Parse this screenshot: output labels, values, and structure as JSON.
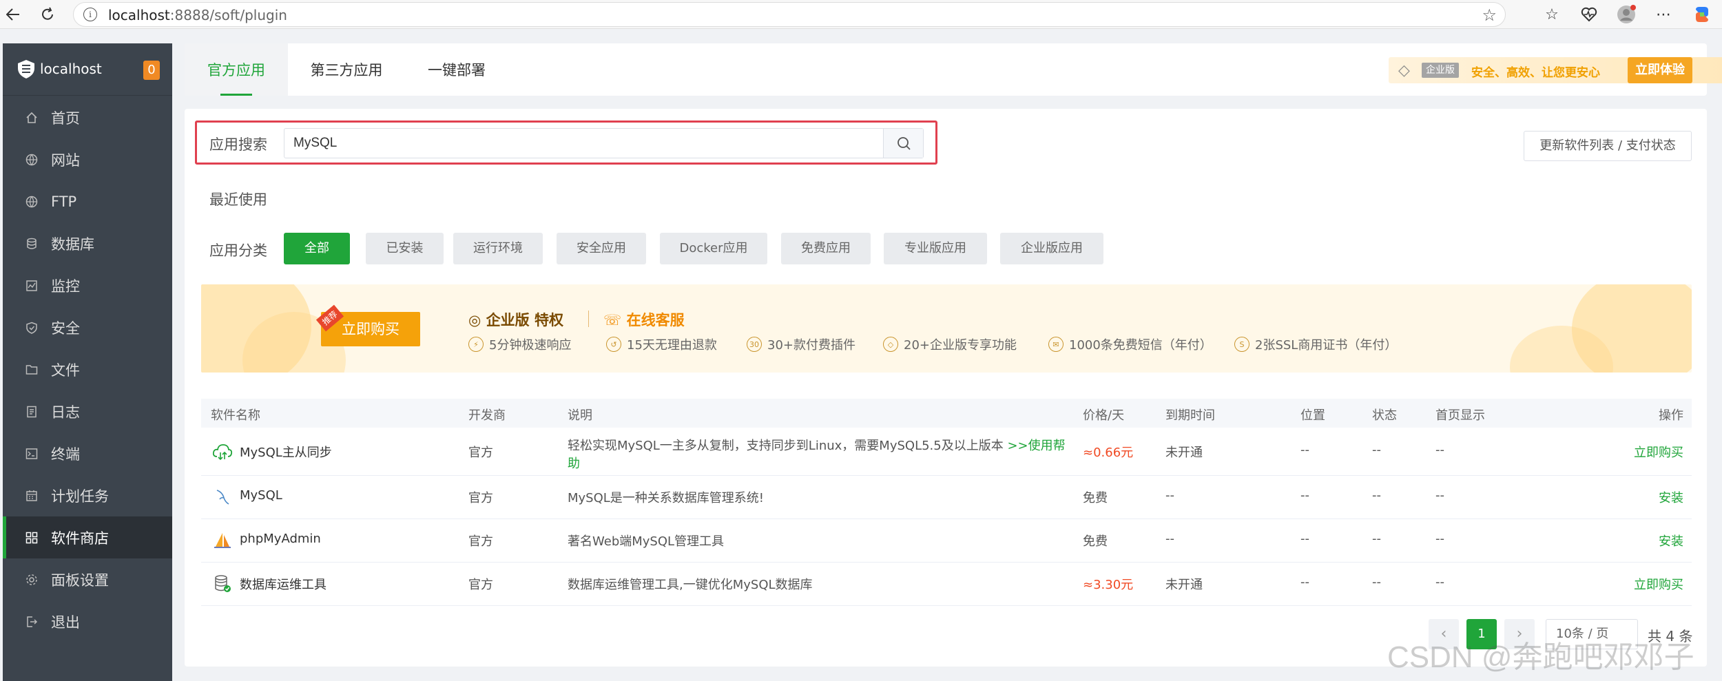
{
  "browser": {
    "url_host": "localhost",
    "url_path": ":8888/soft/plugin"
  },
  "sidebar": {
    "host": "localhost",
    "badge": "0",
    "items": [
      {
        "label": "首页",
        "icon": "home-icon"
      },
      {
        "label": "网站",
        "icon": "globe-icon"
      },
      {
        "label": "FTP",
        "icon": "ftp-globe-icon"
      },
      {
        "label": "数据库",
        "icon": "database-icon"
      },
      {
        "label": "监控",
        "icon": "monitor-icon"
      },
      {
        "label": "安全",
        "icon": "shield-icon"
      },
      {
        "label": "文件",
        "icon": "folder-icon"
      },
      {
        "label": "日志",
        "icon": "log-icon"
      },
      {
        "label": "终端",
        "icon": "terminal-icon"
      },
      {
        "label": "计划任务",
        "icon": "calendar-icon"
      },
      {
        "label": "软件商店",
        "icon": "grid-icon",
        "active": true
      },
      {
        "label": "面板设置",
        "icon": "gear-icon"
      },
      {
        "label": "退出",
        "icon": "logout-icon"
      }
    ]
  },
  "tabs": [
    "官方应用",
    "第三方应用",
    "一键部署"
  ],
  "enterprise": {
    "tag": "企业版",
    "slogan": "安全、高效、让您更安心",
    "button": "立即体验"
  },
  "search": {
    "label": "应用搜索",
    "value": "MySQL"
  },
  "refresh_button": "更新软件列表 / 支付状态",
  "recent_label": "最近使用",
  "category": {
    "label": "应用分类",
    "options": [
      "全部",
      "已安装",
      "运行环境",
      "安全应用",
      "Docker应用",
      "免费应用",
      "专业版应用",
      "企业版应用"
    ],
    "selected": "全部"
  },
  "banner": {
    "tag": "推荐",
    "buy": "立即购买",
    "title": "企业版 特权",
    "service": "在线客服",
    "features": [
      "5分钟极速响应",
      "15天无理由退款",
      "30+款付费插件",
      "20+企业版专享功能",
      "1000条免费短信（年付）",
      "2张SSL商用证书（年付）"
    ]
  },
  "table": {
    "headers": [
      "软件名称",
      "开发商",
      "说明",
      "价格/天",
      "到期时间",
      "位置",
      "状态",
      "首页显示",
      "操作"
    ],
    "rows": [
      {
        "name": "MySQL主从同步",
        "dev": "官方",
        "desc": "轻松实现MySQL一主多从复制，支持同步到Linux，需要MySQL5.5及以上版本",
        "help1": ">>使用帮",
        "help2": "助",
        "price": "≈0.66元",
        "expire": "未开通",
        "location": "--",
        "status": "--",
        "home": "--",
        "action": "立即购买",
        "icon": "cloud-sync-icon"
      },
      {
        "name": "MySQL",
        "dev": "官方",
        "desc": "MySQL是一种关系数据库管理系统!",
        "price": "免费",
        "expire": "--",
        "location": "--",
        "status": "--",
        "home": "--",
        "action": "安装",
        "icon": "mysql-dolphin-icon"
      },
      {
        "name": "phpMyAdmin",
        "dev": "官方",
        "desc": "著名Web端MySQL管理工具",
        "price": "免费",
        "expire": "--",
        "location": "--",
        "status": "--",
        "home": "--",
        "action": "安装",
        "icon": "phpmyadmin-sail-icon"
      },
      {
        "name": "数据库运维工具",
        "dev": "官方",
        "desc": "数据库运维管理工具,一键优化MySQL数据库",
        "price": "≈3.30元",
        "expire": "未开通",
        "location": "--",
        "status": "--",
        "home": "--",
        "action": "立即购买",
        "icon": "db-tool-icon"
      }
    ]
  },
  "pagination": {
    "current": "1",
    "page_size": "10条 / 页",
    "total": "共 4 条"
  },
  "watermark": "CSDN @奔跑吧邓邓子",
  "colors": {
    "accent": "#20a53a",
    "price": "#f04a24",
    "sidebar": "#3c444d",
    "highlight_border": "#e0404f",
    "enterprise_gold": "#f5a623"
  }
}
